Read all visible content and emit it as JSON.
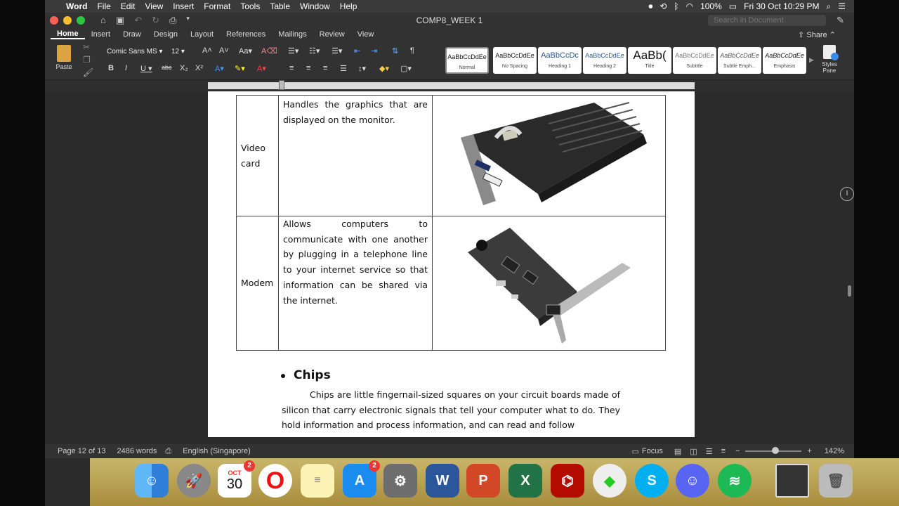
{
  "menubar": {
    "app": "Word",
    "items": [
      "File",
      "Edit",
      "View",
      "Insert",
      "Format",
      "Tools",
      "Table",
      "Window",
      "Help"
    ],
    "battery": "100%",
    "datetime": "Fri 30 Oct  10:29 PM"
  },
  "title": {
    "doc": "COMP8_WEEK 1",
    "search_placeholder": "Search in Document"
  },
  "tabs": [
    "Home",
    "Insert",
    "Draw",
    "Design",
    "Layout",
    "References",
    "Mailings",
    "Review",
    "View"
  ],
  "share": "Share",
  "ribbon": {
    "paste": "Paste",
    "font": "Comic Sans MS",
    "size": "12",
    "styles": [
      {
        "preview": "AaBbCcDdEe",
        "name": "Normal"
      },
      {
        "preview": "AaBbCcDdEe",
        "name": "No Spacing"
      },
      {
        "preview": "AaBbCcDc",
        "name": "Heading 1"
      },
      {
        "preview": "AaBbCcDdEe",
        "name": "Heading 2"
      },
      {
        "preview": "AaBb(",
        "name": "Title"
      },
      {
        "preview": "AaBbCcDdEe",
        "name": "Subtitle"
      },
      {
        "preview": "AaBbCcDdEe",
        "name": "Subtle Emph..."
      },
      {
        "preview": "AaBbCcDdEe",
        "name": "Emphasis"
      }
    ],
    "styles_pane": "Styles Pane"
  },
  "doc": {
    "rows": [
      {
        "label": "Video card",
        "desc": "Handles the graphics that are displayed on the monitor."
      },
      {
        "label": "Modem",
        "desc": "Allows computers to communicate with one another by plugging in a telephone line to your internet service so that information can be shared via the internet."
      }
    ],
    "heading": "Chips",
    "para": "Chips are little fingernail-sized squares on your circuit boards made of silicon that carry electronic signals that tell your computer what to do. They hold information and process information, and can read and follow"
  },
  "status": {
    "page": "Page 12 of 13",
    "words": "2486 words",
    "lang": "English (Singapore)",
    "focus": "Focus",
    "zoom": "142%"
  },
  "dock": {
    "calendar_month": "OCT",
    "calendar_day": "30",
    "calendar_badge": "2",
    "appstore_badge": "2"
  },
  "colors": {
    "ribbon": "#323232",
    "page": "#ffffff",
    "accent_red": "#e33"
  }
}
